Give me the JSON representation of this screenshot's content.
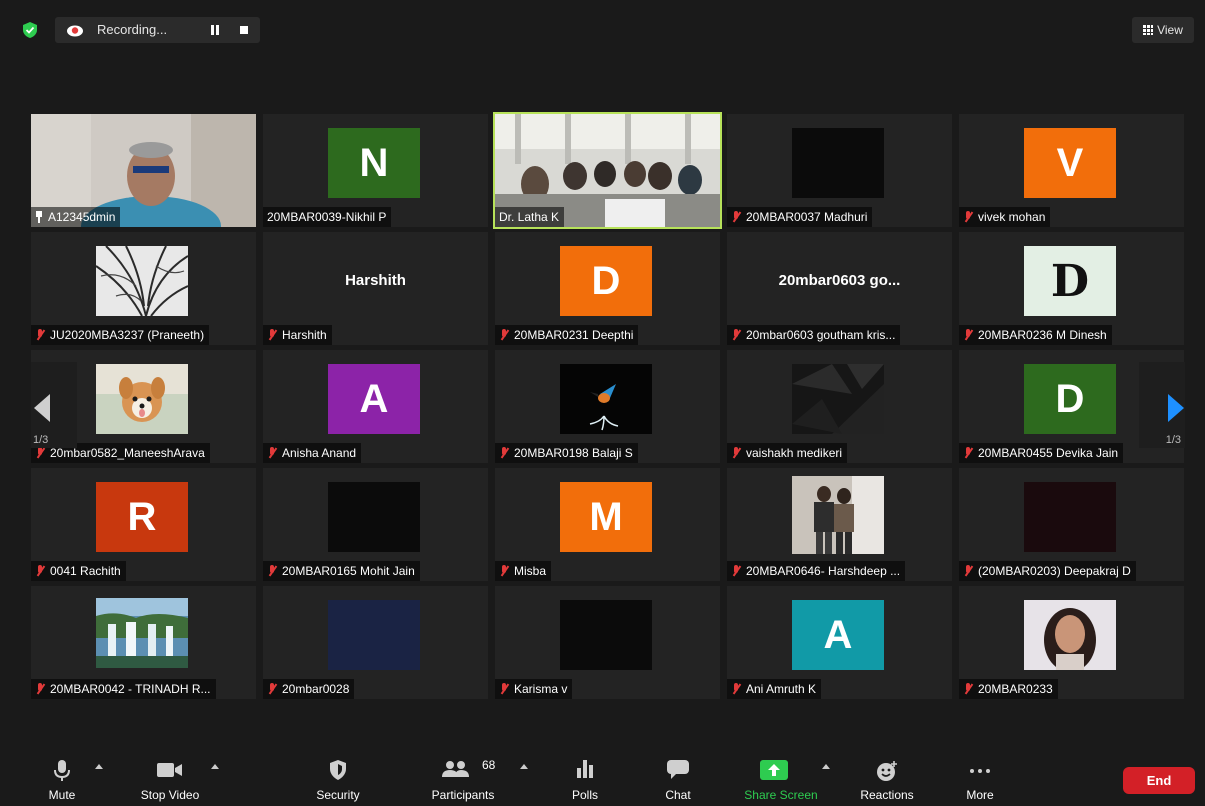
{
  "top_bar": {
    "recording_label": "Recording...",
    "view_label": "View",
    "colors": {
      "shield": "#2ecc50",
      "record": "#e23a3a"
    }
  },
  "gallery": {
    "active_speaker_color": "#b7e25a",
    "page_left": "1/3",
    "page_right": "1/3",
    "tiles": [
      {
        "name": "A12345dmin",
        "muted": false,
        "pinned": true,
        "display": "photo-person"
      },
      {
        "name": "20MBAR0039-Nikhil P",
        "muted": false,
        "avatar_letter": "N",
        "avatar_color": "green"
      },
      {
        "name": "Dr. Latha K",
        "muted": false,
        "display": "photo-classroom",
        "active": true
      },
      {
        "name": "20MBAR0037 Madhuri",
        "muted": true,
        "avatar_color": "black"
      },
      {
        "name": "vivek mohan",
        "muted": true,
        "avatar_letter": "V",
        "avatar_color": "orange"
      },
      {
        "name": "JU2020MBA3237 (Praneeth)",
        "muted": true,
        "display": "photo-tree"
      },
      {
        "name": "Harshith",
        "muted": true,
        "display_name": "Harshith"
      },
      {
        "name": "20MBAR0231 Deepthi",
        "muted": true,
        "avatar_letter": "D",
        "avatar_color": "orange"
      },
      {
        "name": "20mbar0603 goutham kris...",
        "muted": true,
        "display_name": "20mbar0603 go..."
      },
      {
        "name": "20MBAR0236 M Dinesh",
        "muted": true,
        "avatar_letter": "D",
        "avatar_color": "mint"
      },
      {
        "name": "20mbar0582_ManeeshArava",
        "muted": true,
        "display": "photo-dog"
      },
      {
        "name": "Anisha Anand",
        "muted": true,
        "avatar_letter": "A",
        "avatar_color": "purple"
      },
      {
        "name": "20MBAR0198 Balaji S",
        "muted": true,
        "display": "photo-bird"
      },
      {
        "name": "vaishakh medikeri",
        "muted": true,
        "display": "photo-dark-abstract"
      },
      {
        "name": "20MBAR0455 Devika Jain",
        "muted": true,
        "avatar_letter": "D",
        "avatar_color": "green"
      },
      {
        "name": "0041 Rachith",
        "muted": true,
        "avatar_letter": "R",
        "avatar_color": "red"
      },
      {
        "name": "20MBAR0165 Mohit Jain",
        "muted": true,
        "avatar_color": "black"
      },
      {
        "name": "Misba",
        "muted": true,
        "avatar_letter": "M",
        "avatar_color": "orange"
      },
      {
        "name": "20MBAR0646- Harshdeep ...",
        "muted": true,
        "display": "photo-people"
      },
      {
        "name": "(20MBAR0203) Deepakraj D",
        "muted": true,
        "avatar_color": "darkred"
      },
      {
        "name": "20MBAR0042 - TRINADH R...",
        "muted": true,
        "display": "photo-waterfall"
      },
      {
        "name": "20mbar0028",
        "muted": true,
        "avatar_color": "navy"
      },
      {
        "name": "Karisma v",
        "muted": true,
        "avatar_color": "black"
      },
      {
        "name": "Ani Amruth K",
        "muted": true,
        "avatar_letter": "A",
        "avatar_color": "teal"
      },
      {
        "name": "20MBAR0233",
        "muted": true,
        "display": "photo-girl"
      }
    ]
  },
  "toolbar": {
    "mute": "Mute",
    "stop_video": "Stop Video",
    "security": "Security",
    "participants": "Participants",
    "participants_count": "68",
    "polls": "Polls",
    "chat": "Chat",
    "share_screen": "Share Screen",
    "reactions": "Reactions",
    "more": "More",
    "end": "End",
    "colors": {
      "share": "#2ecc50",
      "end": "#d32027"
    }
  }
}
